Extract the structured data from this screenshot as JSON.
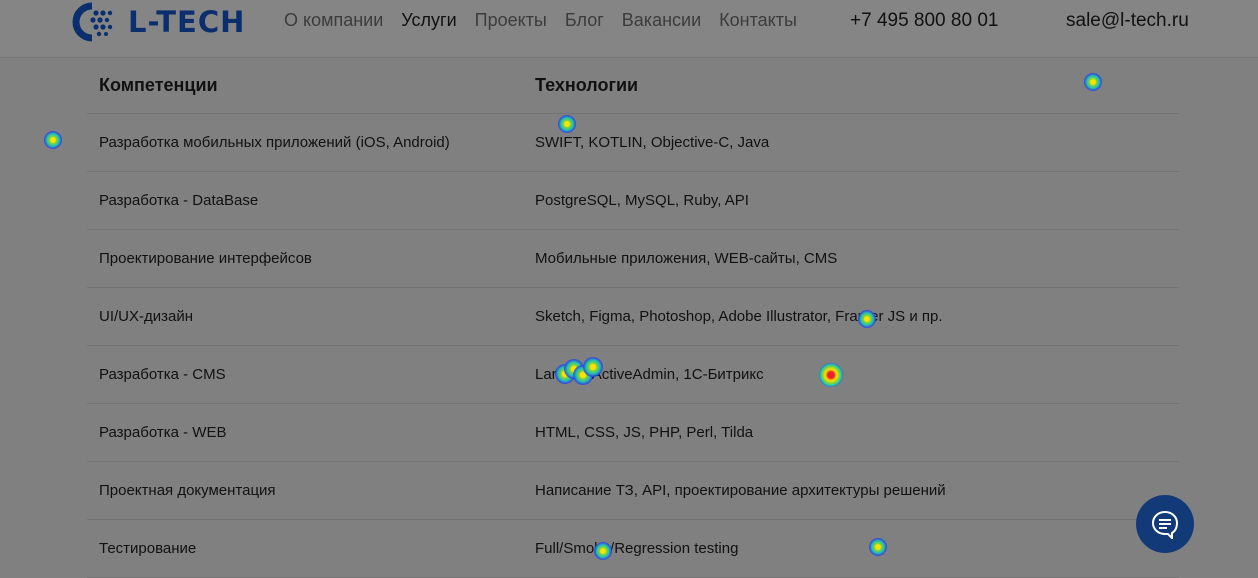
{
  "header": {
    "brand": "L-TECH",
    "nav": [
      {
        "label": "О компании",
        "active": false
      },
      {
        "label": "Услуги",
        "active": true
      },
      {
        "label": "Проекты",
        "active": false
      },
      {
        "label": "Блог",
        "active": false
      },
      {
        "label": "Вакансии",
        "active": false
      },
      {
        "label": "Контакты",
        "active": false
      }
    ],
    "phone": "+7 495 800 80 01",
    "email": "sale@l-tech.ru"
  },
  "table": {
    "headers": [
      "Компетенции",
      "Технологии"
    ],
    "rows": [
      [
        "Разработка мобильных приложений (iOS, Android)",
        "SWIFT, KOTLIN, Objective-C, Java"
      ],
      [
        "Разработка - DataBase",
        "PostgreSQL, MySQL, Ruby, API"
      ],
      [
        "Проектирование интерфейсов",
        "Мобильные приложения, WEB-сайты, CMS"
      ],
      [
        "UI/UX-дизайн",
        "Sketch, Figma, Photoshop, Adobe Illustrator, Framer JS и пр."
      ],
      [
        "Разработка - CMS",
        "Laravel, ActiveAdmin, 1С-Битрикс"
      ],
      [
        "Разработка - WEB",
        "HTML, CSS, JS, PHP, Perl, Tilda"
      ],
      [
        "Проектная документация",
        "Написание ТЗ, API, проектирование архитектуры решений"
      ],
      [
        "Тестирование",
        "Full/Smoke/Regression testing"
      ]
    ]
  },
  "chat_button": {
    "icon": "chat-bubble-icon"
  },
  "colors": {
    "brand": "#0b2f6e",
    "overlay": "#808080",
    "chat": "#123a78"
  }
}
